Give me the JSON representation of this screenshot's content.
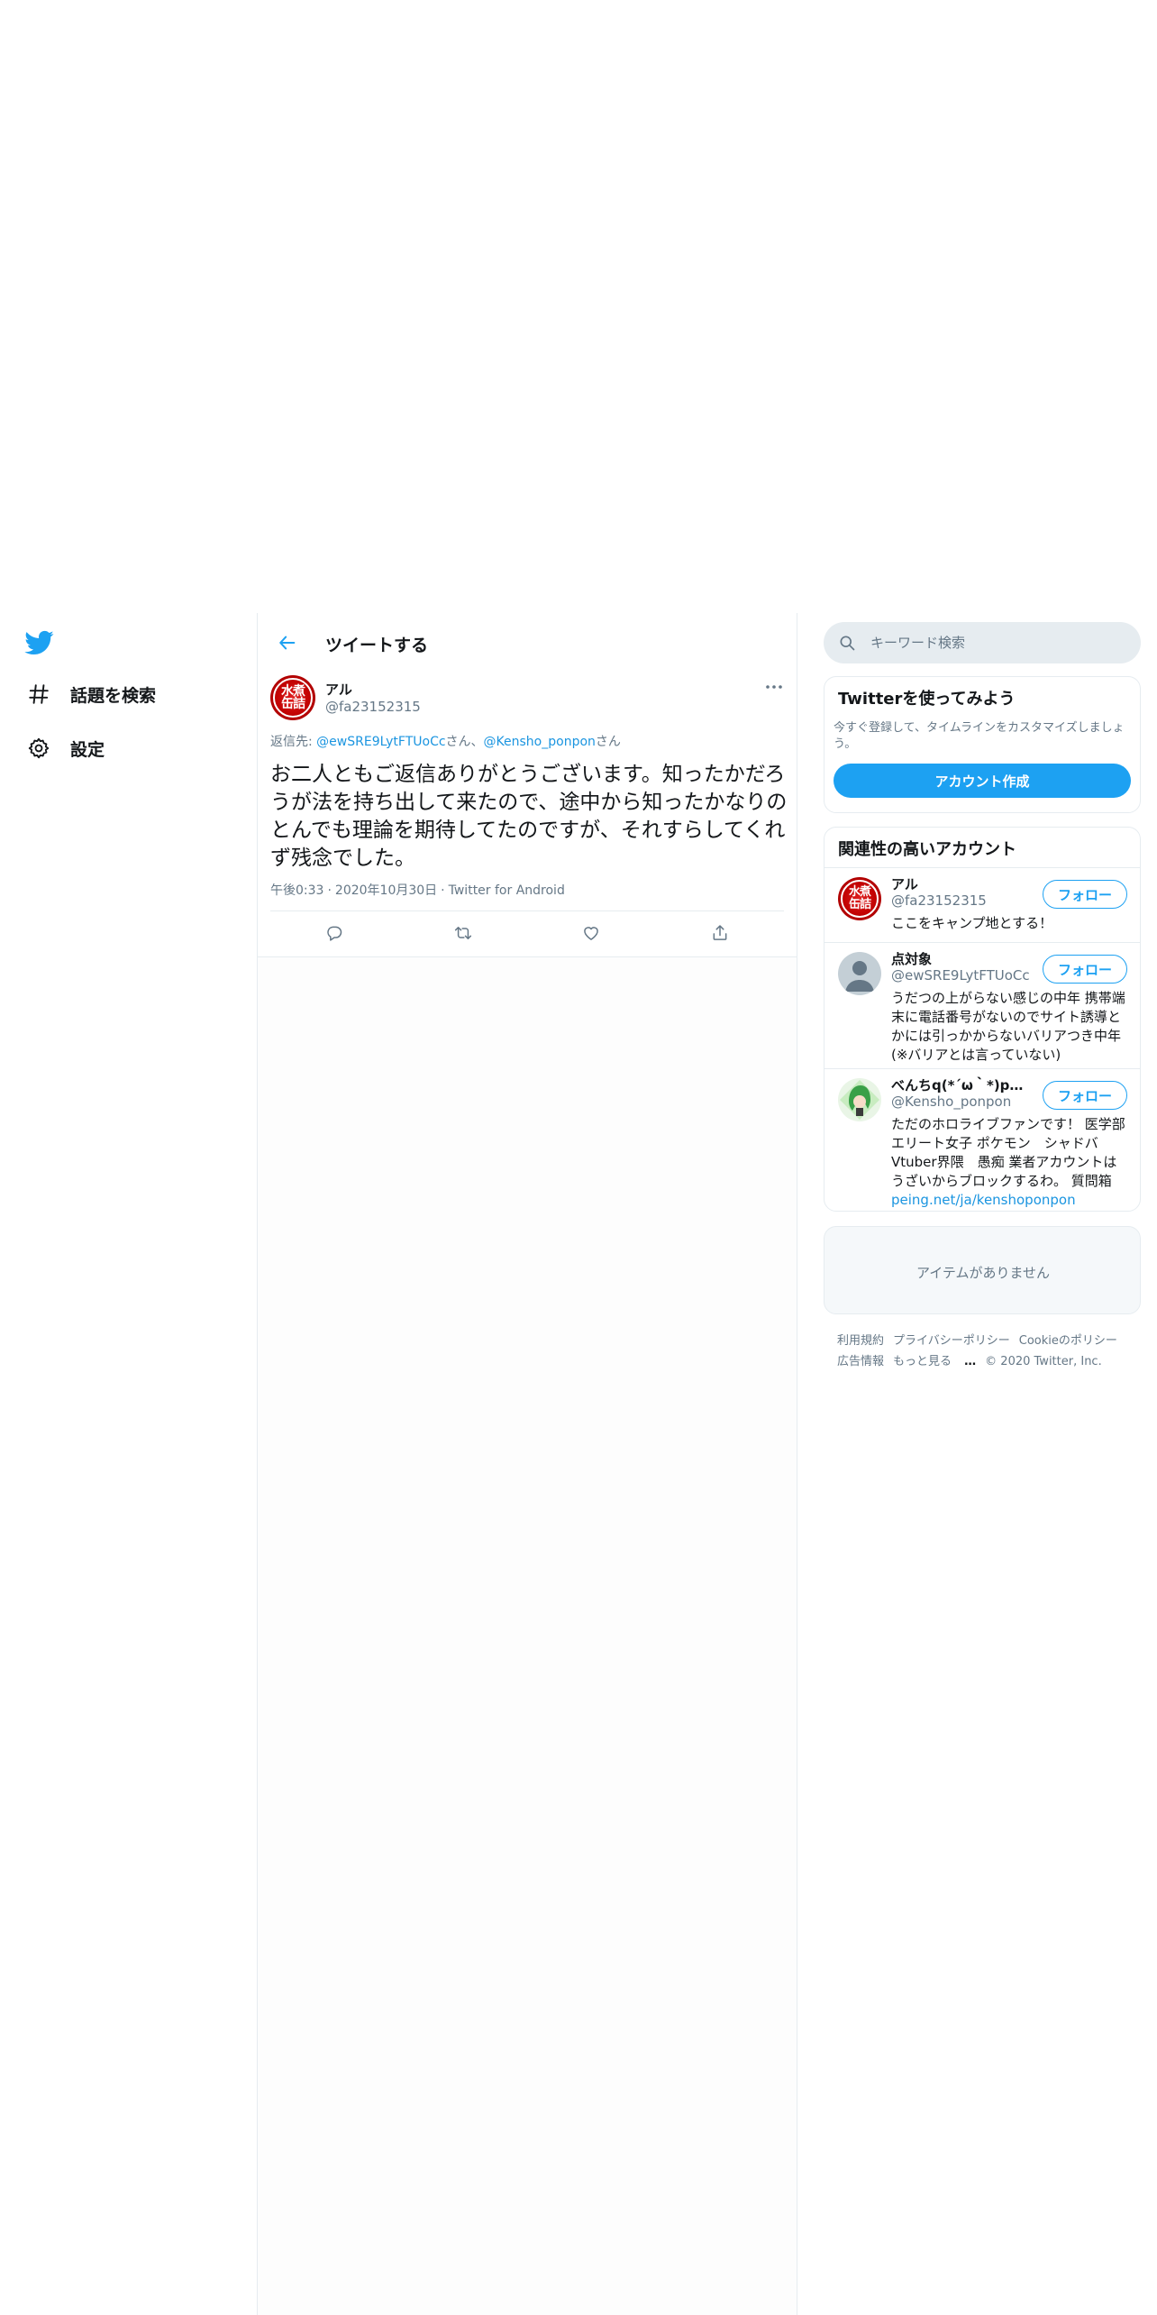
{
  "nav": {
    "items": [
      {
        "label": "話題を検索"
      },
      {
        "label": "設定"
      }
    ]
  },
  "header": {
    "title": "ツイートする"
  },
  "tweet": {
    "author_name": "アル",
    "author_handle": "@fa23152315",
    "avatar_text": "水煮缶詰",
    "reply_prefix": "返信先: ",
    "reply_user1": "@ewSRE9LytFTUoCc",
    "reply_suffix1": "さん、",
    "reply_user2": "@Kensho_ponpon",
    "reply_suffix2": "さん",
    "text": "お二人ともご返信ありがとうございます。知ったかだろうが法を持ち出して来たので、途中から知ったかなりのとんでも理論を期待してたのですが、それすらしてくれず残念でした。",
    "time": "午後0:33",
    "date": "2020年10月30日",
    "dot": "·",
    "source": "Twitter for Android"
  },
  "search": {
    "placeholder": "キーワード検索"
  },
  "signup": {
    "title": "Twitterを使ってみよう",
    "desc": "今すぐ登録して、タイムラインをカスタマイズしましょう。",
    "button": "アカウント作成"
  },
  "related": {
    "title": "関連性の高いアカウント",
    "follow_label": "フォロー",
    "accounts": [
      {
        "name": "アル",
        "handle": "@fa23152315",
        "bio": "ここをキャンプ地とする！"
      },
      {
        "name": "点対象",
        "handle": "@ewSRE9LytFTUoCc",
        "bio": "うだつの上がらない感じの中年 携帯端末に電話番号がないのでサイト誘導とかには引っかからないバリアつき中年(※バリアとは言っていない)"
      },
      {
        "name": "べんちq(*´ω｀*)pち…",
        "handle": "@Kensho_ponpon",
        "bio": "ただのホロライブファンです！ 医学部エリート女子 ポケモン　シャドバ　Vtuber界隈　愚痴 業者アカウントはうざいからブロックするわ。 質問箱",
        "bio_link": "peing.net/ja/kenshoponpon"
      }
    ]
  },
  "trends": {
    "empty": "アイテムがありません"
  },
  "footer": {
    "links": [
      "利用規約",
      "プライバシーポリシー",
      "Cookieのポリシー",
      "広告情報",
      "もっと見る",
      "© 2020 Twitter, Inc."
    ]
  },
  "colors": {
    "brand": "#1da1f2",
    "link": "#1b95e0",
    "muted": "#657786",
    "border": "#e6ecf0"
  }
}
